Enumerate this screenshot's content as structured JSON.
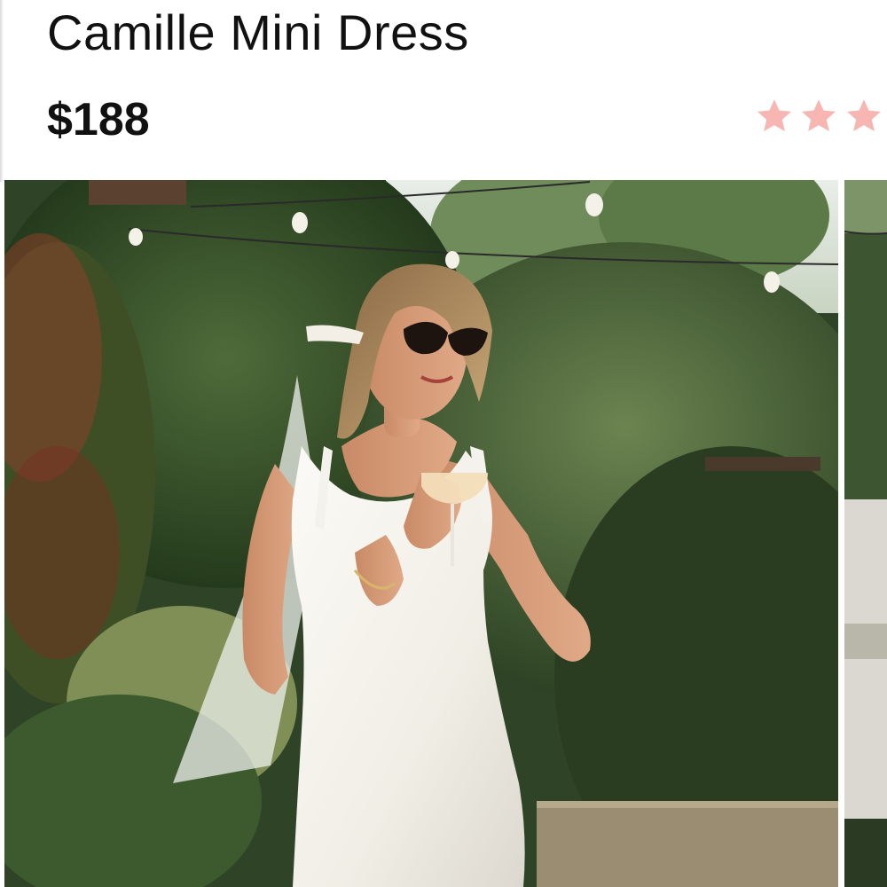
{
  "product": {
    "title": "Camille Mini Dress",
    "price": "$188"
  },
  "rating": {
    "visible_stars": 3,
    "star_icon": "star-icon",
    "star_color": "#f7b6b1"
  },
  "gallery": {
    "current_image_icon": "product-photo",
    "next_image_icon": "product-photo"
  },
  "colors": {
    "text": "#111111",
    "background": "#ffffff",
    "star": "#f7b6b1"
  }
}
